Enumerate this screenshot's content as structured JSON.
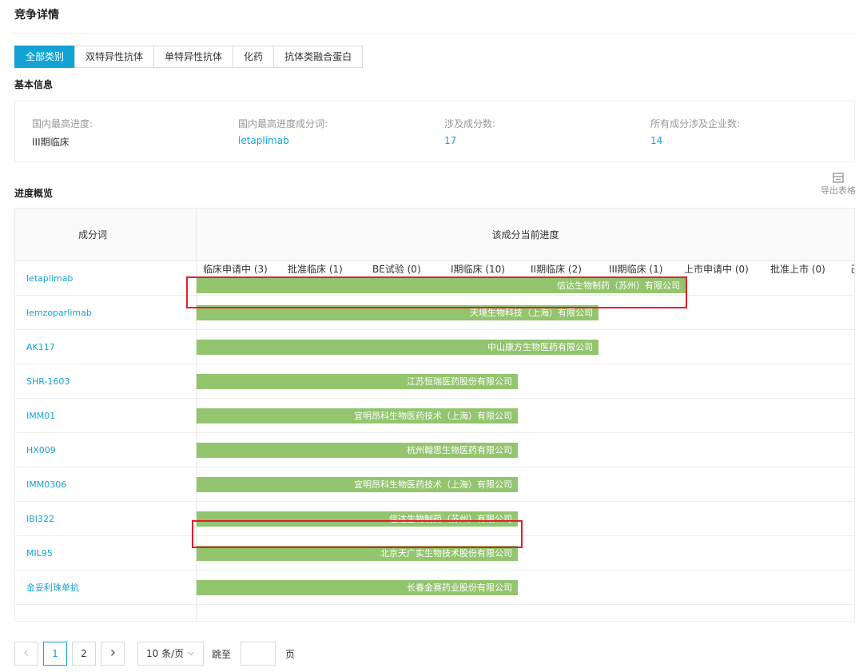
{
  "page_title": "竞争详情",
  "tabs": [
    {
      "label": "全部类别",
      "active": true
    },
    {
      "label": "双特异性抗体",
      "active": false
    },
    {
      "label": "单特异性抗体",
      "active": false
    },
    {
      "label": "化药",
      "active": false
    },
    {
      "label": "抗体类融合蛋白",
      "active": false
    }
  ],
  "basic_info": {
    "title": "基本信息",
    "items": [
      {
        "label": "国内最高进度:",
        "value": "III期临床",
        "link": false
      },
      {
        "label": "国内最高进度成分词:",
        "value": "letaplimab",
        "link": true
      },
      {
        "label": "涉及成分数:",
        "value": "17",
        "link": true
      },
      {
        "label": "所有成分涉及企业数:",
        "value": "14",
        "link": true
      }
    ]
  },
  "progress": {
    "title": "进度概览",
    "export_label": "导出表格",
    "export_icon": "table-export-icon",
    "col_ingredient": "成分词",
    "col_progress": "该成分当前进度",
    "stages": [
      "临床申请中 (3)",
      "批准临床 (1)",
      "BE试验 (0)",
      "I期临床 (10)",
      "II期临床 (2)",
      "III期临床 (1)",
      "上市申请中 (0)",
      "批准上市 (0)",
      "己"
    ],
    "stage_positions": [
      "临床申请中",
      "批准临床",
      "BE试验",
      "I期临床",
      "II期临床",
      "III期临床",
      "上市申请中",
      "批准上市"
    ],
    "rows": [
      {
        "ingredient": "letaplimab",
        "company": "信达生物制药（苏州）有限公司",
        "stage_reached": "III期临床",
        "highlighted": true
      },
      {
        "ingredient": "lemzoparlimab",
        "company": "天境生物科技（上海）有限公司",
        "stage_reached": "II期临床",
        "highlighted": false
      },
      {
        "ingredient": "AK117",
        "company": "中山康方生物医药有限公司",
        "stage_reached": "II期临床",
        "highlighted": false
      },
      {
        "ingredient": "SHR-1603",
        "company": "江苏恒瑞医药股份有限公司",
        "stage_reached": "I期临床",
        "highlighted": false
      },
      {
        "ingredient": "IMM01",
        "company": "宜明昂科生物医药技术（上海）有限公司",
        "stage_reached": "I期临床",
        "highlighted": false
      },
      {
        "ingredient": "HX009",
        "company": "杭州翰思生物医药有限公司",
        "stage_reached": "I期临床",
        "highlighted": false
      },
      {
        "ingredient": "IMM0306",
        "company": "宜明昂科生物医药技术（上海）有限公司",
        "stage_reached": "I期临床",
        "highlighted": false
      },
      {
        "ingredient": "IBI322",
        "company": "信达生物制药（苏州）有限公司",
        "stage_reached": "I期临床",
        "highlighted": true
      },
      {
        "ingredient": "MIL95",
        "company": "北京天广实生物技术股份有限公司",
        "stage_reached": "I期临床",
        "highlighted": false
      },
      {
        "ingredient": "金妥利珠单抗",
        "company": "长春金赛药业股份有限公司",
        "stage_reached": "I期临床",
        "highlighted": false
      }
    ],
    "bar_color": "#93c46e",
    "highlight_color": "#e0212c"
  },
  "pagination": {
    "prev_icon": "chevron-left-icon",
    "next_icon": "chevron-right-icon",
    "pages": [
      "1",
      "2"
    ],
    "current": "1",
    "page_size": "10 条/页",
    "page_size_icon": "chevron-down-icon",
    "jump_label": "跳至",
    "page_suffix": "页"
  },
  "accent_color": "#12a3d6"
}
